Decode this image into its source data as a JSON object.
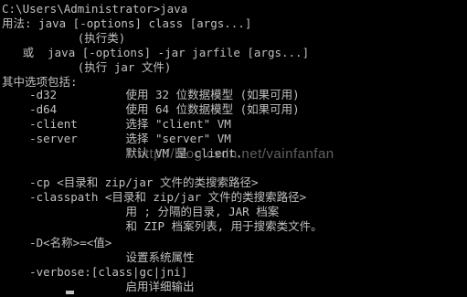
{
  "terminal": {
    "lines": [
      "C:\\Users\\Administrator>java",
      "用法: java [-options] class [args...]",
      "           (执行类)",
      "   或  java [-options] -jar jarfile [args...]",
      "           (执行 jar 文件)",
      "其中选项包括:",
      "    -d32          使用 32 位数据模型 (如果可用)",
      "    -d64          使用 64 位数据模型 (如果可用)",
      "    -client       选择 \"client\" VM",
      "    -server       选择 \"server\" VM",
      "                  默认 VM 是 client.",
      "",
      "    -cp <目录和 zip/jar 文件的类搜索路径>",
      "    -classpath <目录和 zip/jar 文件的类搜索路径>",
      "                  用 ; 分隔的目录, JAR 档案",
      "                  和 ZIP 档案列表, 用于搜索类文件。",
      "    -D<名称>=<值>",
      "                  设置系统属性",
      "    -verbose:[class|gc|jni]",
      "                  启用详细输出"
    ]
  },
  "watermark": {
    "text": "http://blog.csdn.net/vainfanfan"
  },
  "colors": {
    "background": "#000000",
    "text": "#c0c0c0"
  }
}
